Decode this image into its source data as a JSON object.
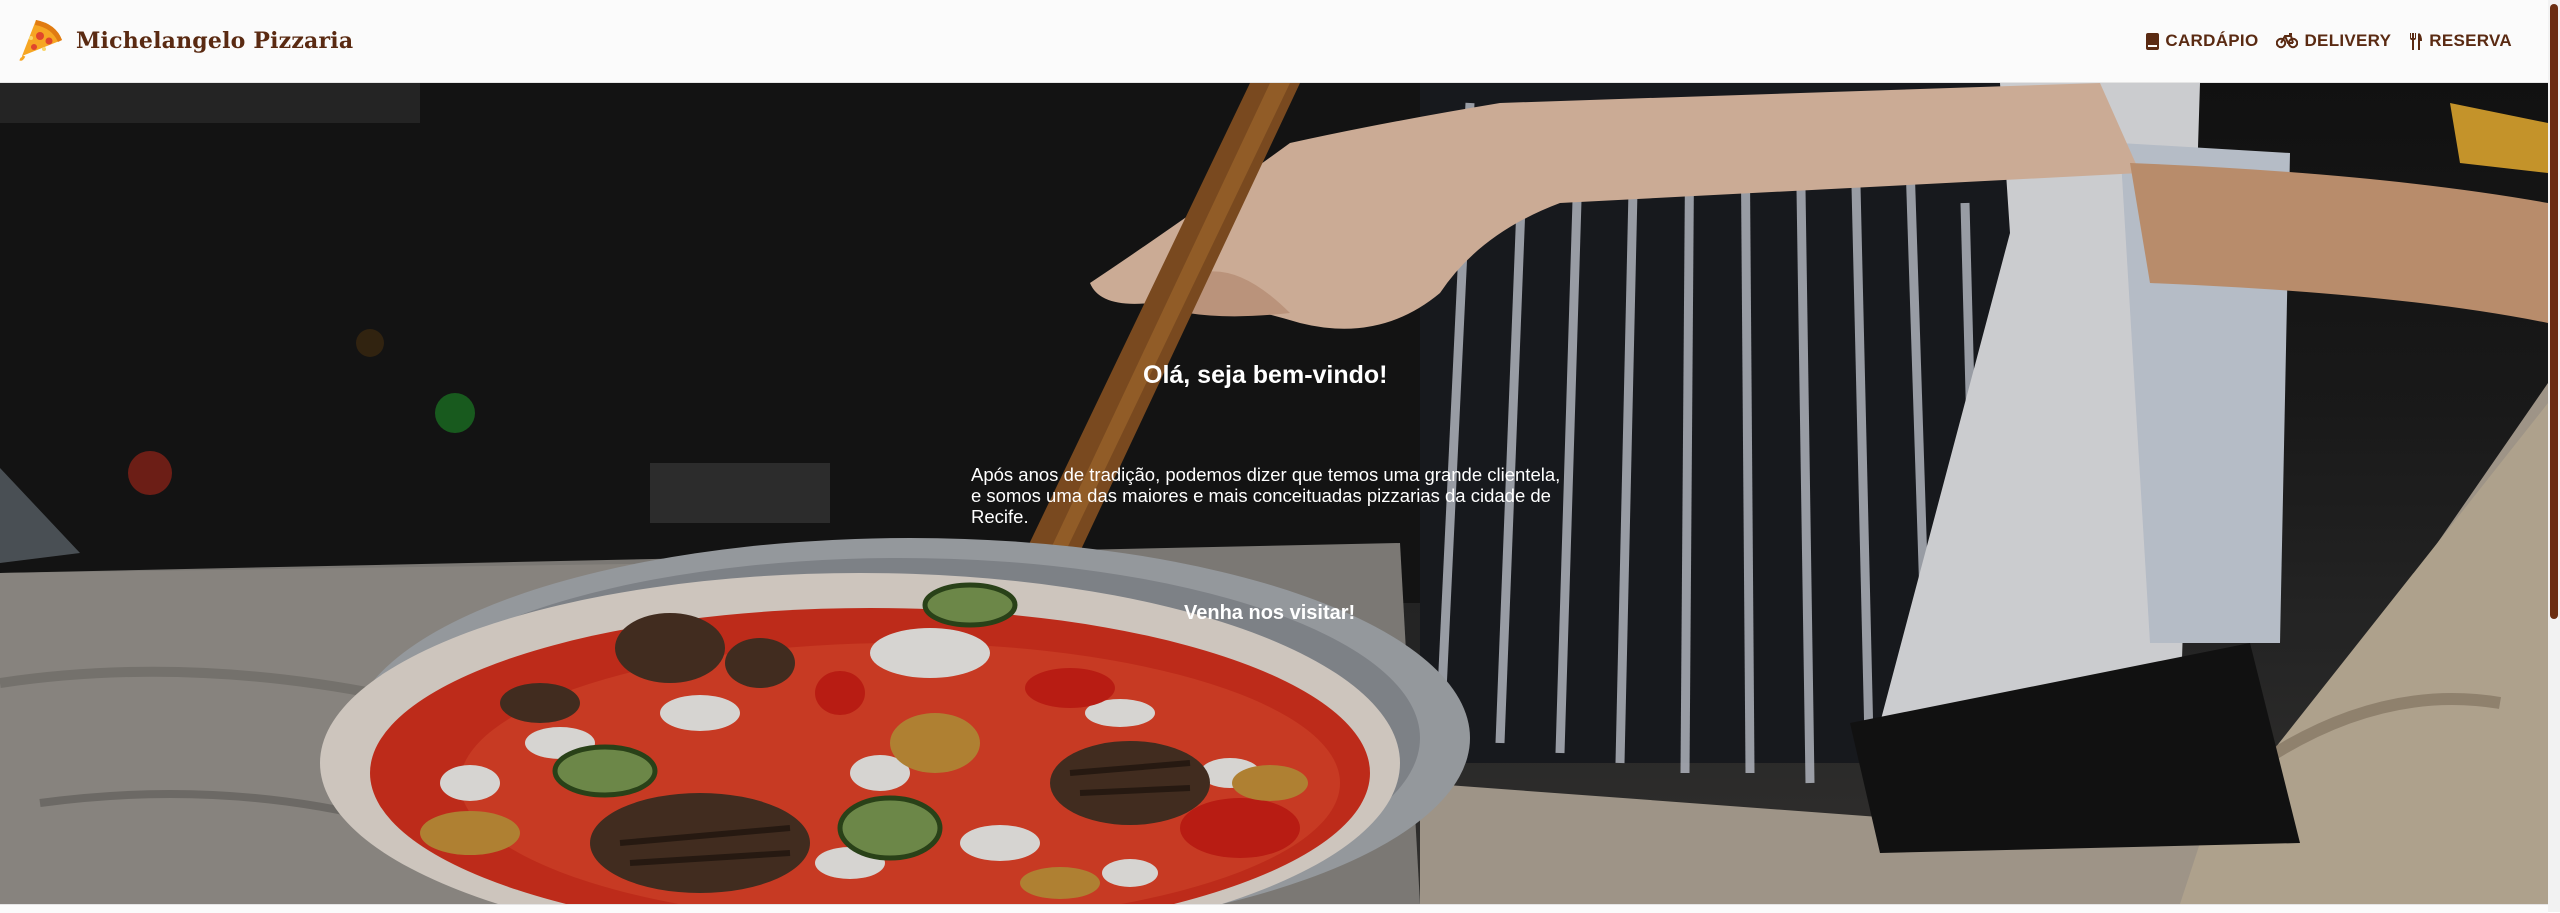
{
  "brand": {
    "name": "Michelangelo Pizzaria",
    "logo_icon": "pizza-slice-icon"
  },
  "nav": {
    "items": [
      {
        "label": "CARDÁPIO",
        "icon": "menu-book-icon"
      },
      {
        "label": "DELIVERY",
        "icon": "bicycle-icon"
      },
      {
        "label": "RESERVA",
        "icon": "fork-knife-icon"
      }
    ]
  },
  "hero": {
    "welcome": "Olá, seja bem-vindo!",
    "description": "Após anos de tradição, podemos dizer que temos uma grande clientela, e somos uma das maiores e mais conceituadas pizzarias da cidade de Recife.",
    "cta": "Venha nos visitar!"
  },
  "colors": {
    "brand_text": "#5a2a12",
    "scrollbar_thumb": "#6b2e12",
    "header_bg": "#fbfbfb"
  }
}
